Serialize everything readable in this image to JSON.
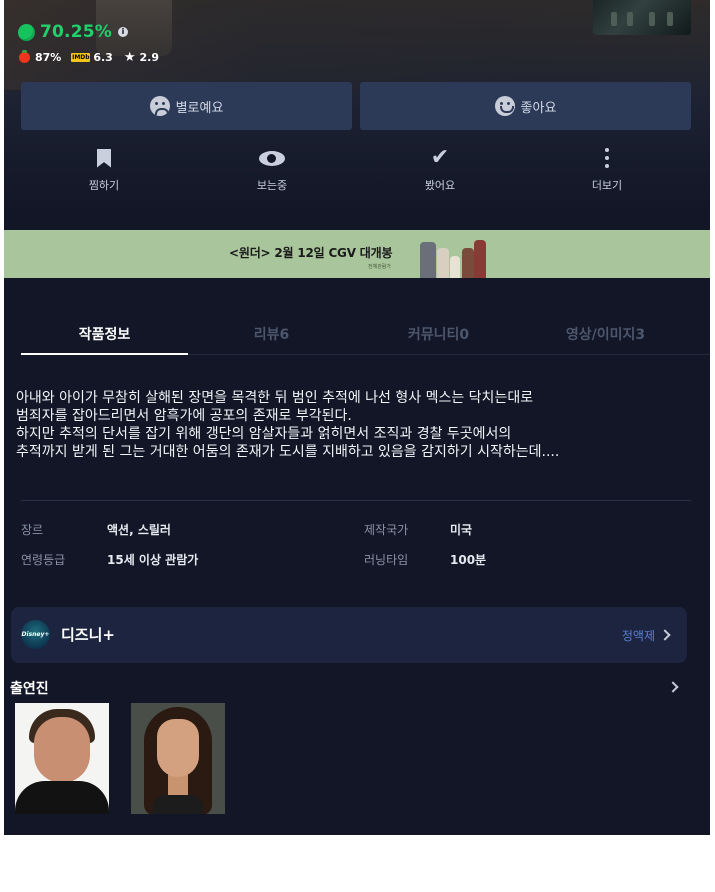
{
  "hero": {
    "score_value": "70.25%",
    "info_glyph": "i",
    "tomato_score": "87%",
    "imdb_logo_text": "IMDb",
    "imdb_score": "6.3",
    "star_score": "2.9"
  },
  "reactions": {
    "dislike_label": "별로예요",
    "like_label": "좋아요"
  },
  "actions": [
    {
      "label": "찜하기",
      "icon": "bookmark-icon"
    },
    {
      "label": "보는중",
      "icon": "eye-icon"
    },
    {
      "label": "봤어요",
      "icon": "check-icon"
    },
    {
      "label": "더보기",
      "icon": "more-icon"
    }
  ],
  "banner": {
    "text": "<원더> 2월 12일 CGV 대개봉",
    "sub": "전체관람가"
  },
  "tabs": [
    {
      "label": "작품정보",
      "active": true
    },
    {
      "label": "리뷰6",
      "active": false
    },
    {
      "label": "커뮤니티0",
      "active": false
    },
    {
      "label": "영상/이미지3",
      "active": false
    }
  ],
  "synopsis": [
    "아내와 아이가 무참히 살해된 장면을 목격한 뒤 범인 추적에 나선 형사 멕스는 닥치는대로",
    "범죄자를 잡아드리면서 암흑가에 공포의 존재로 부각된다.",
    "하지만 추적의 단서를 잡기 위해 갱단의 암살자들과 얽히면서 조직과 경찰 두곳에서의",
    "추적까지 받게 된 그는 거대한 어둠의 존재가 도시를 지배하고 있음을 감지하기 시작하는데...."
  ],
  "meta": {
    "genre_label": "장르",
    "genre_value": "액션, 스릴러",
    "country_label": "제작국가",
    "country_value": "미국",
    "age_label": "연령등급",
    "age_value": "15세 이상 관람가",
    "runtime_label": "러닝타임",
    "runtime_value": "100분"
  },
  "ott": {
    "icon_text": "Disney+",
    "name": "디즈니+",
    "plan": "정액제"
  },
  "cast": {
    "title": "출연진"
  },
  "colors": {
    "background": "#121626",
    "score_green": "#1fd06b",
    "button_bg": "#2c3a58",
    "ott_bg": "#1c2440",
    "banner_bg": "#a9c59b",
    "plan_link": "#5a7fd6"
  }
}
